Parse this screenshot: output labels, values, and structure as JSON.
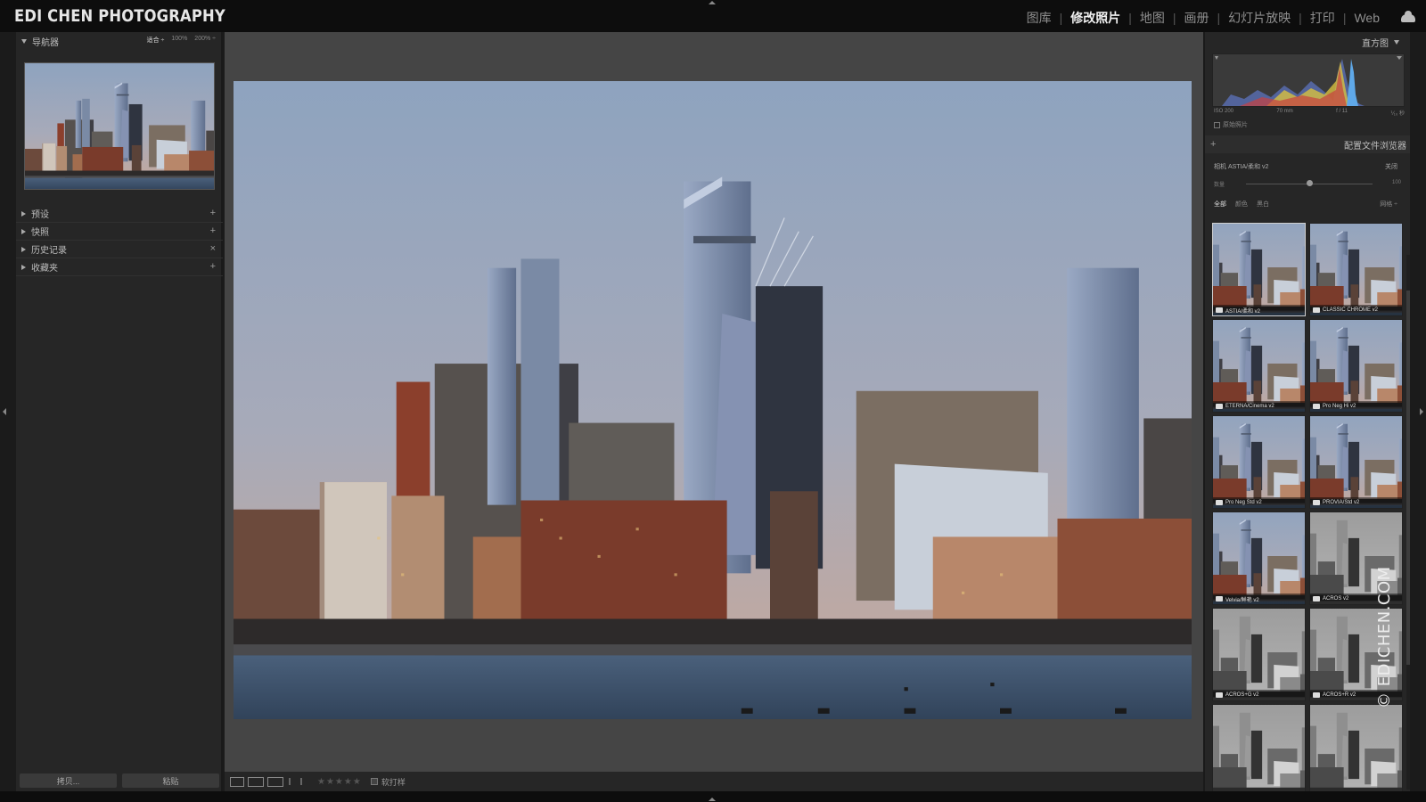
{
  "brand": "EDI CHEN PHOTOGRAPHY",
  "modules": [
    {
      "label": "图库",
      "active": false
    },
    {
      "label": "修改照片",
      "active": true
    },
    {
      "label": "地图",
      "active": false
    },
    {
      "label": "画册",
      "active": false
    },
    {
      "label": "幻灯片放映",
      "active": false
    },
    {
      "label": "打印",
      "active": false
    },
    {
      "label": "Web",
      "active": false
    }
  ],
  "left": {
    "navigator_title": "导航器",
    "zoom": [
      "适合 ÷",
      "100%",
      "200% ÷"
    ],
    "sections": [
      {
        "label": "预设",
        "action": "+"
      },
      {
        "label": "快照",
        "action": "+"
      },
      {
        "label": "历史记录",
        "action": "×"
      },
      {
        "label": "收藏夹",
        "action": "+"
      }
    ],
    "copy_button": "拷贝...",
    "paste_button": "粘贴"
  },
  "toolbar": {
    "softproof_label": "软打样",
    "rating": "★★★★★"
  },
  "right": {
    "histogram_title": "直方图",
    "iso": "ISO 200",
    "focal": "70 mm",
    "aperture": "f / 11",
    "shutter": "⅟₁₀ 秒",
    "original_photo": "原始照片",
    "profile_browser_title": "配置文件浏览器",
    "profile_name": "相机 ASTIA/柔和 v2",
    "close_label": "关闭",
    "amount_label": "数量",
    "amount_value": "100",
    "amount_fraction": 0.5,
    "filters": [
      "全部",
      "颜色",
      "黑白"
    ],
    "grid_label": "网格 ÷",
    "profiles": [
      {
        "label": "ASTIA/柔和 v2",
        "mono": false
      },
      {
        "label": "CLASSIC CHROME v2",
        "mono": false
      },
      {
        "label": "ETERNA/Cinema v2",
        "mono": false
      },
      {
        "label": "Pro Neg Hi v2",
        "mono": false
      },
      {
        "label": "Pro Neg Std v2",
        "mono": false
      },
      {
        "label": "PROVIA/Std v2",
        "mono": false
      },
      {
        "label": "Velvia/鲜艳 v2",
        "mono": false
      },
      {
        "label": "ACROS v2",
        "mono": true
      },
      {
        "label": "ACROS+G v2",
        "mono": true
      },
      {
        "label": "ACROS+R v2",
        "mono": true
      },
      {
        "label": "",
        "mono": true
      },
      {
        "label": "",
        "mono": true
      }
    ]
  },
  "watermark": "© EDICHEN.COM",
  "colors": {
    "sky_top": "#8ea3bf",
    "sky_bottom": "#c7a79a",
    "water": "#3e5570",
    "brick": "#6b3a2a",
    "glass": "#7487a6"
  }
}
